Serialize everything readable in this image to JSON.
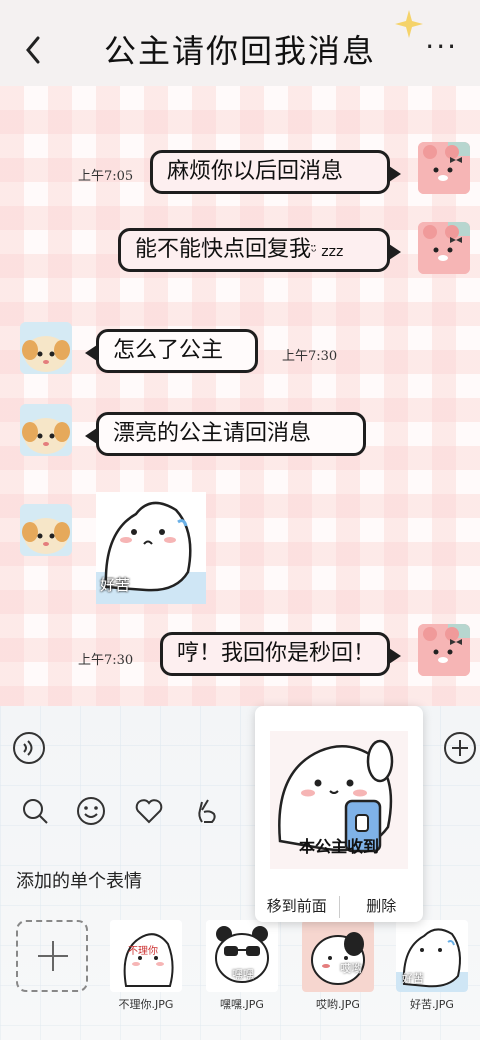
{
  "header": {
    "title": "公主请你回我消息",
    "back_glyph": "‹",
    "more_glyph": "···"
  },
  "messages": [
    {
      "side": "right",
      "time": "上午7:05",
      "text": "麻烦你以后回消息"
    },
    {
      "side": "right",
      "time": "",
      "text": "能不能快点回复我",
      "suffix": "ᵕ̈ zzz"
    },
    {
      "side": "left",
      "time": "上午7:30",
      "text": "怎么了公主"
    },
    {
      "side": "left",
      "time": "",
      "text": "漂亮的公主请回消息"
    },
    {
      "side": "left",
      "time": "",
      "sticker_caption": "好苦"
    },
    {
      "side": "right",
      "time": "上午7:30",
      "text": "哼！我回你是秒回！"
    }
  ],
  "popup": {
    "caption": "本公主收到",
    "move_front": "移到前面",
    "delete": "删除"
  },
  "panel": {
    "section_label": "添加的单个表情",
    "stickers": [
      {
        "name": "不理你.JPG",
        "caption": "不理你"
      },
      {
        "name": "嘿嘿.JPG",
        "caption": "嘿嘿"
      },
      {
        "name": "哎哟.JPG",
        "caption": "哎哟"
      },
      {
        "name": "好苦.JPG",
        "caption": "好苦"
      }
    ]
  },
  "colors": {
    "bubble_border": "#1e1e1e",
    "bubble_fill": "#fdeff0",
    "grid_pink": "#fad6d4",
    "sparkle": "#f5d36a"
  }
}
